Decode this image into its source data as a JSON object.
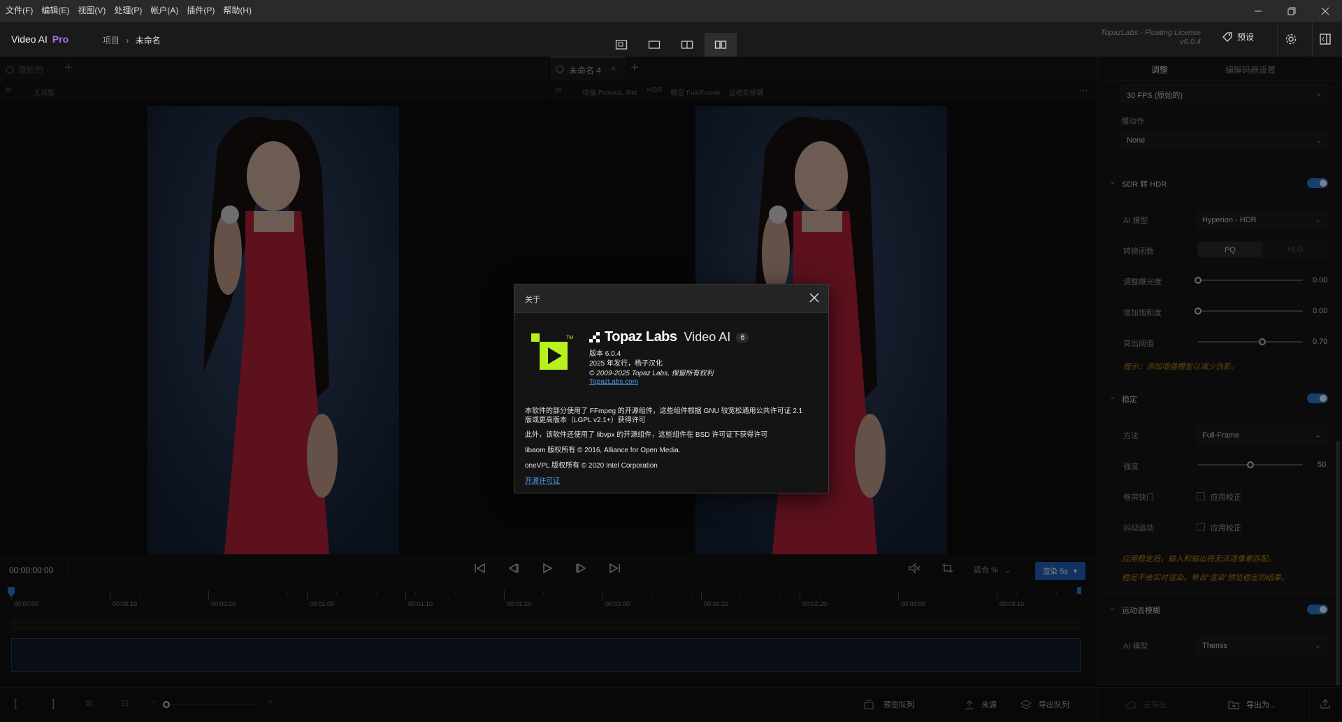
{
  "menubar": {
    "items": [
      "文件(F)",
      "编辑(E)",
      "视图(V)",
      "处理(P)",
      "帐户(A)",
      "插件(P)",
      "帮助(H)"
    ]
  },
  "header": {
    "app_name": "Video AI",
    "app_tier": "Pro",
    "breadcrumb_project": "项目",
    "breadcrumb_current": "未命名",
    "license_text": "TopazLabs - Floating License",
    "version_text": "v6.0.4",
    "preset_label": "预设",
    "view_modes": [
      "single-view-icon",
      "fullscreen-view-icon",
      "split-view-icon",
      "side-by-side-view-icon"
    ]
  },
  "left_panel": {
    "tab_label": "原始的",
    "sub_label": "无调整"
  },
  "right_preview": {
    "tab_label": "未命名 4",
    "sub_items": [
      "增强 Proteus, Rel.",
      "HDR",
      "稳定 Full-Frame",
      "运动去模糊"
    ]
  },
  "settings_panel": {
    "tabs": [
      "调整",
      "编解码器设置"
    ],
    "fps_value": "30 FPS (原始的)",
    "action_label": "慢动作",
    "action_value": "None",
    "hdr": {
      "title": "SDR 转 HDR",
      "model_label": "AI 模型",
      "model_value": "Hyperion - HDR",
      "transfer_label": "转换函数",
      "transfer_options": [
        "PQ",
        "HLG"
      ],
      "exposure_label": "调整曝光度",
      "exposure_value": "0.00",
      "exposure_pos": 0.0,
      "saturation_label": "增加饱和度",
      "saturation_value": "0.00",
      "saturation_pos": 0.0,
      "highlight_label": "突出阈值",
      "highlight_value": "0.70",
      "highlight_pos": 0.61,
      "hint": "提示：添加增强模型以减少伪影。"
    },
    "stabilize": {
      "title": "稳定",
      "method_label": "方法",
      "method_value": "Full-Frame",
      "strength_label": "强度",
      "strength_value": "50",
      "strength_pos": 0.5,
      "rolling_label": "卷帘快门",
      "rolling_check": "应用校正",
      "jitter_label": "抖动运动",
      "jitter_check": "应用校正",
      "note1": "应用稳定后，输入和输出将无法逐像素匹配。",
      "note2": "稳定不会实时渲染。单击\"渲染\"预览稳定的结果。"
    },
    "deblur": {
      "title": "运动去模糊",
      "model_label": "AI 模型",
      "model_value": "Themis"
    }
  },
  "timeline": {
    "timecode": "00:00:00:00",
    "zoom_label": "适合 %",
    "render_label": "渲染 5s",
    "ticks": [
      "00:00:00",
      "00:00:10",
      "00:00:20",
      "00:01:00",
      "00:01:10",
      "00:01:20",
      "00:02:00",
      "00:02:10",
      "00:02:20",
      "00:03:00",
      "00:03:10"
    ]
  },
  "bottom_bar": {
    "preview_queue": "预览队列",
    "source": "来源",
    "export_queue": "导出队列",
    "cloud_export": "云导出",
    "export_as": "导出为..."
  },
  "about_dialog": {
    "title": "关于",
    "brand": "Topaz Labs",
    "product": "Video AI",
    "major_version": "6",
    "version_line": "版本 6.0.4",
    "release_line": "2025 年发行，杨子汉化",
    "copyright_line": "© 2009-2025 Topaz Labs, 保留所有权利",
    "website": "TopazLabs.com",
    "ffmpeg_line1": "本软件的部分使用了 FFmpeg 的开源组件，这些组件根据 GNU 较宽松通用公共许可证 2.1",
    "ffmpeg_line2": "版或更高版本（LGPL v2.1+）获得许可",
    "libvpx_line": "此外，该软件还使用了 libvpx 的开源组件，这些组件在 BSD 许可证下获得许可",
    "libaom_line": "libaom 版权所有 © 2016, Alliance for Open Media.",
    "onevpl_line": "oneVPL 版权所有 © 2020 Intel Corporation",
    "license_link": "开源许可证"
  },
  "colors": {
    "accent_blue": "#2f7fe0",
    "pro_purple": "#b06cf0",
    "topaz_green": "#b8f01c",
    "hint_orange": "#c98a1a"
  }
}
